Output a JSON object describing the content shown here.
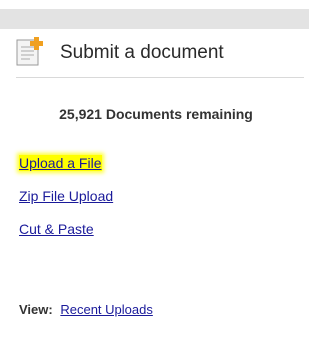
{
  "panel": {
    "title": "Submit a document",
    "icon": "document-add-icon",
    "remaining_text": "25,921 Documents remaining"
  },
  "links": {
    "upload_file": "Upload a File",
    "zip_upload": "Zip File Upload",
    "cut_paste": "Cut & Paste"
  },
  "view": {
    "label": "View:",
    "recent_uploads": "Recent Uploads"
  },
  "colors": {
    "link": "#1a1a9a",
    "highlight": "#ffff00",
    "icon_accent": "#f0a020"
  }
}
